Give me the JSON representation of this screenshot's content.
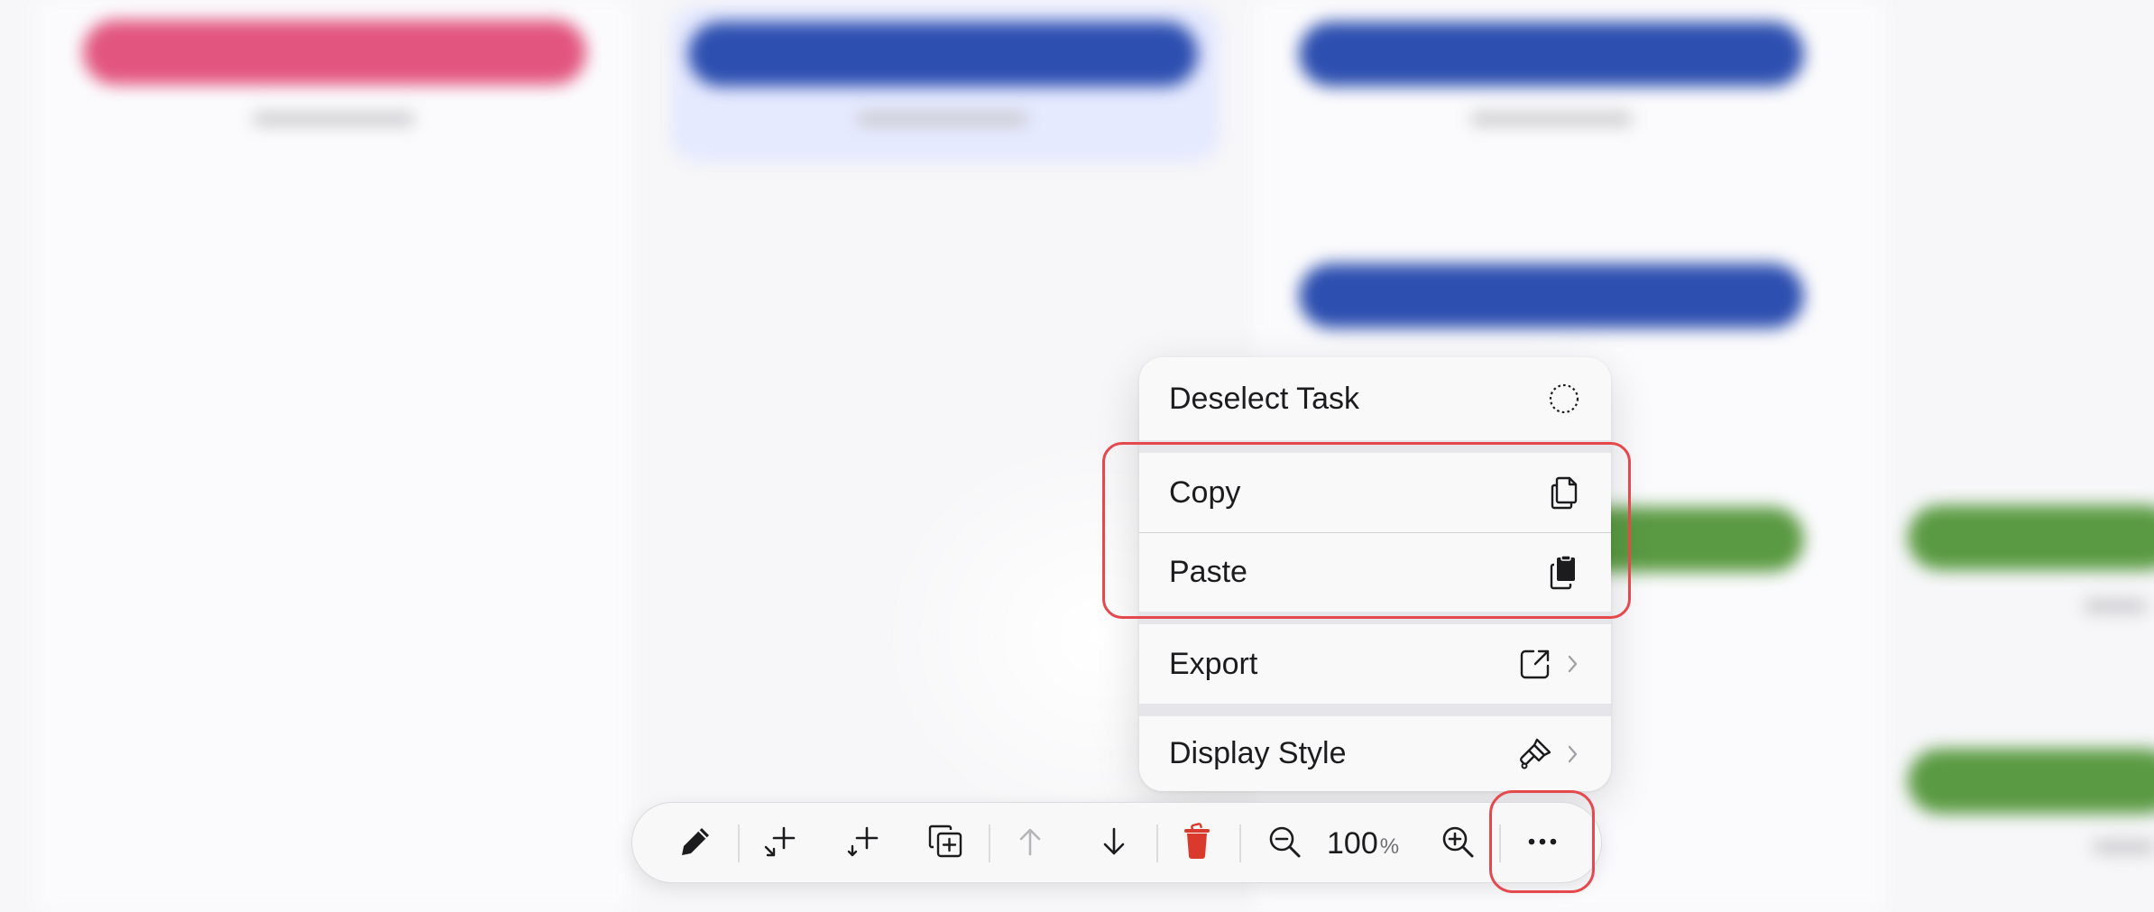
{
  "menu": {
    "items": [
      {
        "label": "Deselect Task",
        "icon": "dashed-circle-icon",
        "has_submenu": false
      },
      {
        "label": "Copy",
        "icon": "copy-documents-icon",
        "has_submenu": false
      },
      {
        "label": "Paste",
        "icon": "paste-clipboard-icon",
        "has_submenu": false
      },
      {
        "label": "Export",
        "icon": "share-export-icon",
        "has_submenu": true
      },
      {
        "label": "Display Style",
        "icon": "paintbrush-icon",
        "has_submenu": true
      }
    ]
  },
  "toolbar": {
    "buttons": [
      {
        "icon": "pencil-icon",
        "enabled": true
      },
      {
        "icon": "add-subtask-icon",
        "enabled": true
      },
      {
        "icon": "add-sibling-task-icon",
        "enabled": true
      },
      {
        "icon": "duplicate-icon",
        "enabled": true
      },
      {
        "icon": "move-up-arrow-icon",
        "enabled": false
      },
      {
        "icon": "move-down-arrow-icon",
        "enabled": true
      },
      {
        "icon": "trash-icon",
        "enabled": true
      },
      {
        "icon": "zoom-out-icon",
        "enabled": true
      },
      {
        "icon": "zoom-in-icon",
        "enabled": true
      },
      {
        "icon": "more-ellipsis-icon",
        "enabled": true
      }
    ],
    "zoom": {
      "value": "100",
      "unit": "%"
    }
  },
  "colors": {
    "pink_task": "#e2557f",
    "blue_task": "#2d4fb0",
    "green_task": "#5a9a42",
    "delete_red": "#d93a2c",
    "annotation_red": "#e5484d",
    "disabled_gray": "#b5b5ba"
  }
}
